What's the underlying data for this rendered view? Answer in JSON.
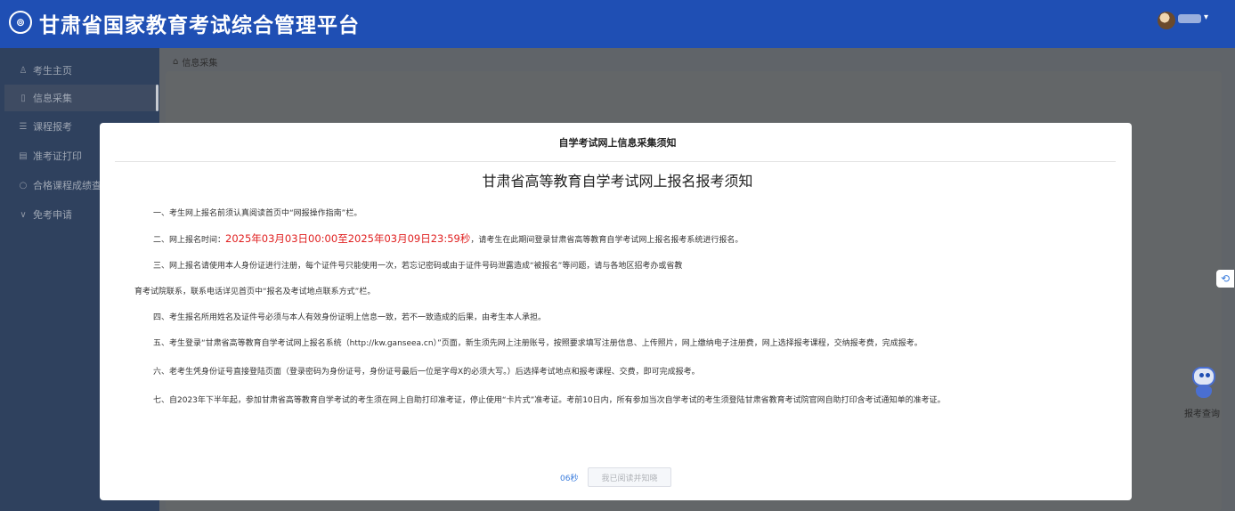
{
  "header": {
    "logo_text": "⊚",
    "title": "甘肃省国家教育考试综合管理平台",
    "user_caret": "▾"
  },
  "sidebar": {
    "items": [
      {
        "icon": "person-icon",
        "glyph": "♙",
        "label": "考生主页"
      },
      {
        "icon": "document-icon",
        "glyph": "▯",
        "label": "信息采集"
      },
      {
        "icon": "list-icon",
        "glyph": "☰",
        "label": "课程报考"
      },
      {
        "icon": "print-icon",
        "glyph": "▤",
        "label": "准考证打印"
      },
      {
        "icon": "search-icon",
        "glyph": "○",
        "label": "合格课程成绩查"
      },
      {
        "icon": "check-icon",
        "glyph": "∨",
        "label": "免考申请"
      }
    ]
  },
  "breadcrumb": {
    "home_glyph": "⌂",
    "label": "信息采集"
  },
  "modal": {
    "title": "自学考试网上信息采集须知",
    "heading": "甘肃省高等教育自学考试网上报名报考须知",
    "p1": "一、考生网上报名前须认真阅读首页中“网报操作指南”栏。",
    "p2_prefix": "二、网上报名时间：",
    "p2_time": "2025年03月03日00:00至2025年03月09日23:59秒",
    "p2_suffix": "，请考生在此期间登录甘肃省高等教育自学考试网上报名报考系统进行报名。",
    "p3a": "三、网上报名请使用本人身份证进行注册，每个证件号只能使用一次，若忘记密码或由于证件号码泄露造成“被报名”等问题，请与各地区招考办或省教",
    "p3b": "育考试院联系，联系电话详见首页中“报名及考试地点联系方式”栏。",
    "p4": "四、考生报名所用姓名及证件号必须与本人有效身份证明上信息一致，若不一致造成的后果，由考生本人承担。",
    "p5": "五、考生登录“甘肃省高等教育自学考试网上报名系统（http://kw.ganseea.cn）”页面，新生须先网上注册账号，按照要求填写注册信息、上传照片，网上缴纳电子注册费，网上选择报考课程，交纳报考费，完成报考。",
    "p6": "六、老考生凭身份证号直接登陆页面（登录密码为身份证号，身份证号最后一位是字母X的必须大写。）后选择考试地点和报考课程、交费，即可完成报考。",
    "p7": "七、自2023年下半年起，参加甘肃省高等教育自学考试的考生须在网上自助打印准考证，停止使用“卡片式”准考证。考前10日内，所有参加当次自学考试的考生须登陆甘肃省教育考试院官网自助打印含考试通知单的准考证。",
    "countdown": "06秒",
    "confirm_label": "我已阅读并知晓"
  },
  "float": {
    "edge_glyph": "⟲",
    "robot_label": "报考查询"
  },
  "colors": {
    "header_bg": "#1f4fb4",
    "sidebar_bg": "#2f415e",
    "time_red": "#e02020",
    "countdown_blue": "#3b7ddd"
  }
}
